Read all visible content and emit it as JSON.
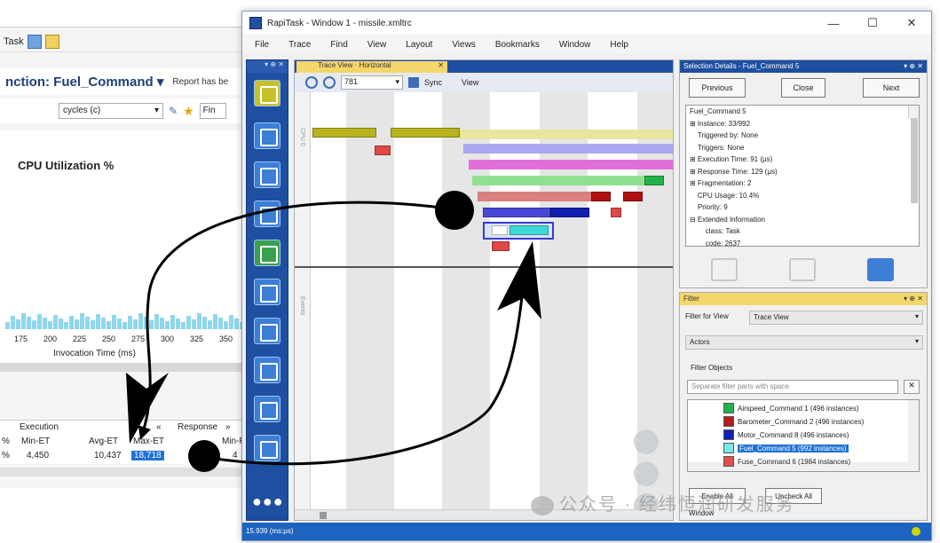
{
  "background_window": {
    "toolbar_label": "Task",
    "function_title": "nction: Fuel_Command ▾",
    "report_text": "Report has be",
    "cycles_select": "cycles (c)",
    "find_label": "Fin",
    "chart_title": "CPU Utilization %",
    "x_ticks": [
      "175",
      "200",
      "225",
      "250",
      "275",
      "300",
      "325",
      "350"
    ],
    "x_label": "Invocation Time (ms)",
    "grid": {
      "group_execution": "Execution",
      "group_response": "Response",
      "headers": [
        "%",
        "Min-ET",
        "Avg-ET",
        "Max-ET",
        "Min-RT"
      ],
      "row": [
        "%",
        "4,450",
        "10,437",
        "18,718",
        "4"
      ]
    }
  },
  "window": {
    "title": "RapiTask - Window 1 - missile.xmltrc",
    "controls": [
      "—",
      "☐",
      "✕"
    ],
    "menu": [
      "File",
      "Trace",
      "Find",
      "View",
      "Layout",
      "Views",
      "Bookmarks",
      "Window",
      "Help"
    ]
  },
  "trace_view": {
    "tab_label": "Trace View · Horizontal",
    "tab_close": "✕",
    "zoom_value": "781",
    "sync_label": "Sync",
    "view_label": "View",
    "upper_axis_label": "CPU 0",
    "lower_axis_label": "Events"
  },
  "selection": {
    "header": "Selection Details - Fuel_Command 5",
    "buttons": [
      "Previous",
      "Close",
      "Next"
    ],
    "tree": [
      "Fuel_Command 5",
      "⊞ Instance: 33/992",
      "    Triggered by: None",
      "    Triggers: None",
      "⊞ Execution Time: 91 (μs)",
      "⊞ Response Time: 129 (μs)",
      "⊞ Fragmentation: 2",
      "    CPU Usage: 10.4%",
      "    Priority: 9",
      "⊟ Extended Information",
      "        class: Task",
      "        code: 2637"
    ]
  },
  "filter": {
    "header": "Filter",
    "filter_for_view_label": "Filter for View",
    "filter_for_view_value": "Trace View",
    "actors_value": "Actors",
    "filter_objects_label": "Filter Objects",
    "search_placeholder": "Separate filter parts with space",
    "clear_label": "✕",
    "items": [
      {
        "label": "Airspeed_Command 1 (496 instances)",
        "color": "#22b24a"
      },
      {
        "label": "Barometer_Command 2 (496 instances)",
        "color": "#b01e1e"
      },
      {
        "label": "Motor_Command 8 (496 instances)",
        "color": "#1020b0"
      },
      {
        "label": "Fuel_Command 5 (992 instances)",
        "color": "#7ae8e8"
      },
      {
        "label": "Fuse_Command 6 (1984 instances)",
        "color": "#e05050"
      }
    ],
    "enable_all": "Enable All",
    "uncheck_all": "Uncheck All",
    "window_label": "Window"
  },
  "status": {
    "text": "15.939 (ms:μs)"
  },
  "watermark": "公众号 · 经纬恒润研发服务",
  "colors": {
    "chrome_blue": "#1f4fa0",
    "highlight_yellow": "#f4d76a",
    "selection_blue": "#1e72d6"
  }
}
